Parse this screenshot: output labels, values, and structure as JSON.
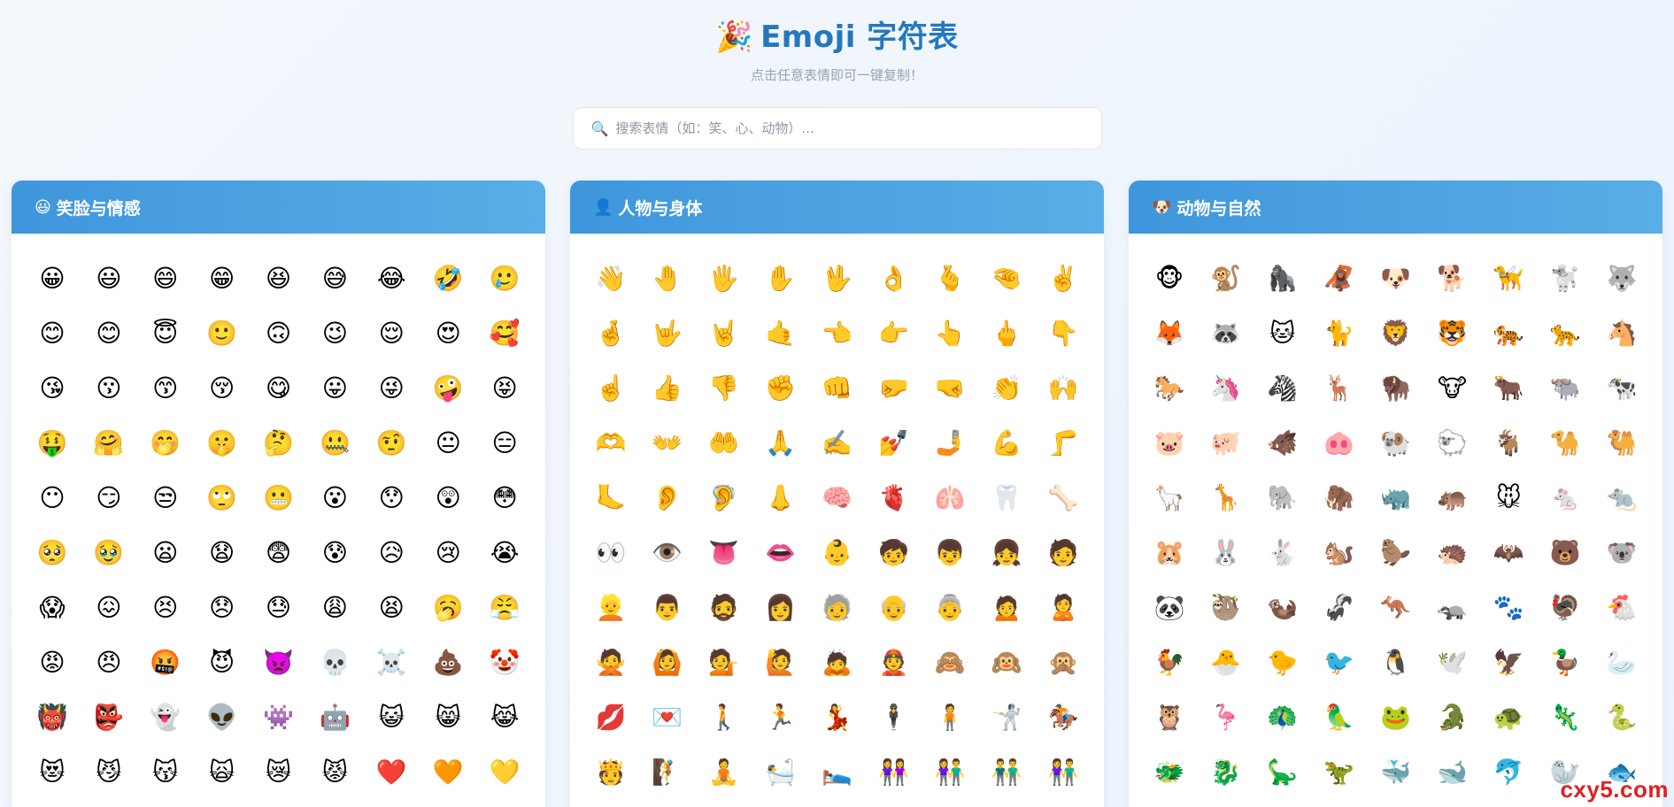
{
  "header": {
    "title_icon": "🎉",
    "title": "Emoji 字符表",
    "subtitle": "点击任意表情即可一键复制！"
  },
  "search": {
    "icon": "🔍",
    "placeholder": "搜索表情（如：笑、心、动物）..."
  },
  "categories": [
    {
      "icon": "😃",
      "name": "笑脸与情感",
      "emojis": [
        "😀",
        "😃",
        "😄",
        "😁",
        "😆",
        "😅",
        "😂",
        "🤣",
        "🥲",
        "😊",
        "😊",
        "😇",
        "🙂",
        "🙃",
        "😉",
        "😌",
        "😍",
        "🥰",
        "😘",
        "😗",
        "😙",
        "😚",
        "😋",
        "😛",
        "😜",
        "🤪",
        "😝",
        "🤑",
        "🤗",
        "🤭",
        "🤫",
        "🤔",
        "🤐",
        "🤨",
        "😐",
        "😑",
        "😶",
        "😏",
        "😒",
        "🙄",
        "😬",
        "😮",
        "😯",
        "😲",
        "😳",
        "🥺",
        "🥹",
        "😦",
        "😧",
        "😨",
        "😰",
        "😥",
        "😢",
        "😭",
        "😱",
        "😖",
        "😣",
        "😞",
        "😓",
        "😩",
        "😫",
        "🥱",
        "😤",
        "😡",
        "😠",
        "🤬",
        "😈",
        "👿",
        "💀",
        "☠️",
        "💩",
        "🤡",
        "👹",
        "👺",
        "👻",
        "👽",
        "👾",
        "🤖",
        "😺",
        "😸",
        "😹",
        "😻",
        "😼",
        "😽",
        "🙀",
        "😿",
        "😾",
        "❤️",
        "🧡",
        "💛"
      ]
    },
    {
      "icon": "👤",
      "name": "人物与身体",
      "emojis": [
        "👋",
        "🤚",
        "🖐️",
        "✋",
        "🖖",
        "👌",
        "🫰",
        "🤏",
        "✌️",
        "🤞",
        "🤟",
        "🤘",
        "🤙",
        "👈",
        "👉",
        "👆",
        "🖕",
        "👇",
        "☝️",
        "👍",
        "👎",
        "✊",
        "👊",
        "🤛",
        "🤜",
        "👏",
        "🙌",
        "🫶",
        "👐",
        "🤲",
        "🙏",
        "✍️",
        "💅",
        "🤳",
        "💪",
        "🦵",
        "🦶",
        "👂",
        "🦻",
        "👃",
        "🧠",
        "🫀",
        "🫁",
        "🦷",
        "🦴",
        "👀",
        "👁️",
        "👅",
        "👄",
        "👶",
        "🧒",
        "👦",
        "👧",
        "🧑",
        "👱",
        "👨",
        "🧔",
        "👩",
        "🧓",
        "👴",
        "👵",
        "🙍",
        "🙎",
        "🙅",
        "🙆",
        "💁",
        "🙋",
        "🙇",
        "👲",
        "🙈",
        "🙉",
        "🙊",
        "💋",
        "💌",
        "🚶",
        "🏃",
        "💃",
        "🕴️",
        "🧍",
        "🤺",
        "🏇",
        "🫅",
        "🧗",
        "🧘",
        "🛀",
        "🛌",
        "👭",
        "👫",
        "👬",
        "👫"
      ]
    },
    {
      "icon": "🐶",
      "name": "动物与自然",
      "emojis": [
        "🐵",
        "🐒",
        "🦍",
        "🦧",
        "🐶",
        "🐕",
        "🦮",
        "🐩",
        "🐺",
        "🦊",
        "🦝",
        "🐱",
        "🐈",
        "🦁",
        "🐯",
        "🐅",
        "🐆",
        "🐴",
        "🐎",
        "🦄",
        "🦓",
        "🦌",
        "🦬",
        "🐮",
        "🐂",
        "🐃",
        "🐄",
        "🐷",
        "🐖",
        "🐗",
        "🐽",
        "🐏",
        "🐑",
        "🐐",
        "🐪",
        "🐫",
        "🦙",
        "🦒",
        "🐘",
        "🦣",
        "🦏",
        "🦛",
        "🐭",
        "🐁",
        "🐀",
        "🐹",
        "🐰",
        "🐇",
        "🐿️",
        "🦫",
        "🦔",
        "🦇",
        "🐻",
        "🐨",
        "🐼",
        "🦥",
        "🦦",
        "🦨",
        "🦘",
        "🦡",
        "🐾",
        "🦃",
        "🐔",
        "🐓",
        "🐣",
        "🐤",
        "🐦",
        "🐧",
        "🕊️",
        "🦅",
        "🦆",
        "🦢",
        "🦉",
        "🦩",
        "🦚",
        "🦜",
        "🐸",
        "🐊",
        "🐢",
        "🦎",
        "🐍",
        "🐲",
        "🐉",
        "🦕",
        "🦖",
        "🐳",
        "🐋",
        "🐬",
        "🦭",
        "🐟"
      ]
    }
  ],
  "watermark": "cxy5.com"
}
